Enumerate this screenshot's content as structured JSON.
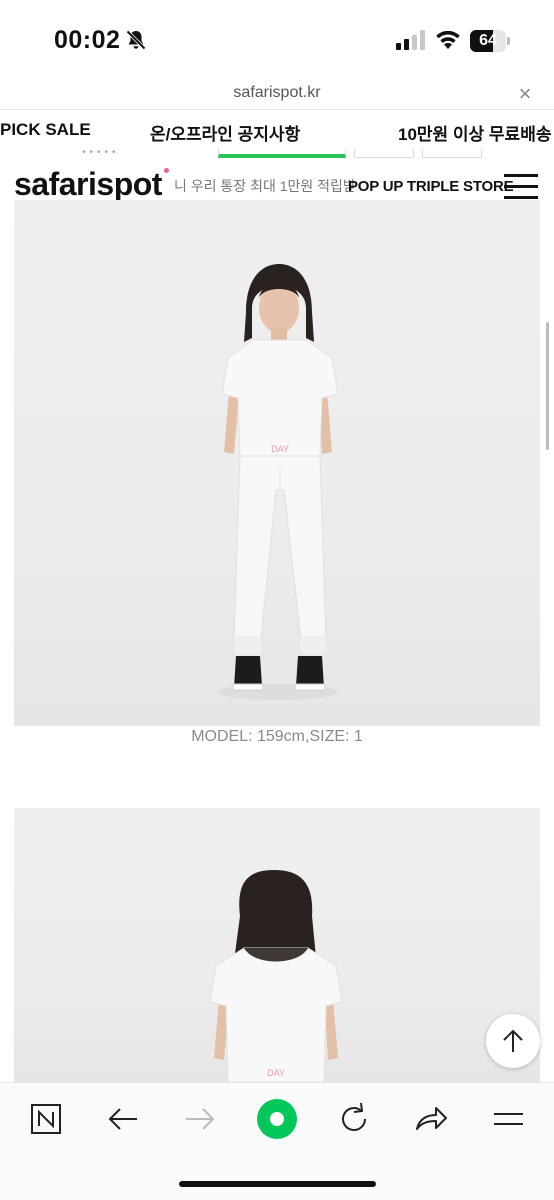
{
  "status_bar": {
    "time": "00:02",
    "battery": "64",
    "battery_level": 0.64
  },
  "browser": {
    "url": "safarispot.kr",
    "close_glyph": "×"
  },
  "notice_bar": {
    "items": [
      "PICK SALE",
      "온/오프라인 공지사항",
      "10만원 이상 무료배송"
    ]
  },
  "header": {
    "logo": "safarispot",
    "ticker": "니 우리 통장 최대 1만원 적립받",
    "popup_link": "POP UP TRIPLE STORE"
  },
  "product": {
    "photo_1_caption": "MODEL: 159cm,SIZE: 1",
    "print_text": "DAY"
  },
  "icons": {
    "bell": "bell-slash-icon",
    "signal": "cellular-signal-icon",
    "wifi": "wifi-icon",
    "menu": "hamburger-menu-icon",
    "top": "arrow-up-icon",
    "toolbar": [
      "naver-n-icon",
      "back-arrow-icon",
      "forward-arrow-icon",
      "green-dot-icon",
      "reload-icon",
      "share-icon",
      "hamburger-menu-icon"
    ]
  },
  "colors": {
    "accent_green": "#27c35a",
    "logo_mark": "#e7609a"
  }
}
